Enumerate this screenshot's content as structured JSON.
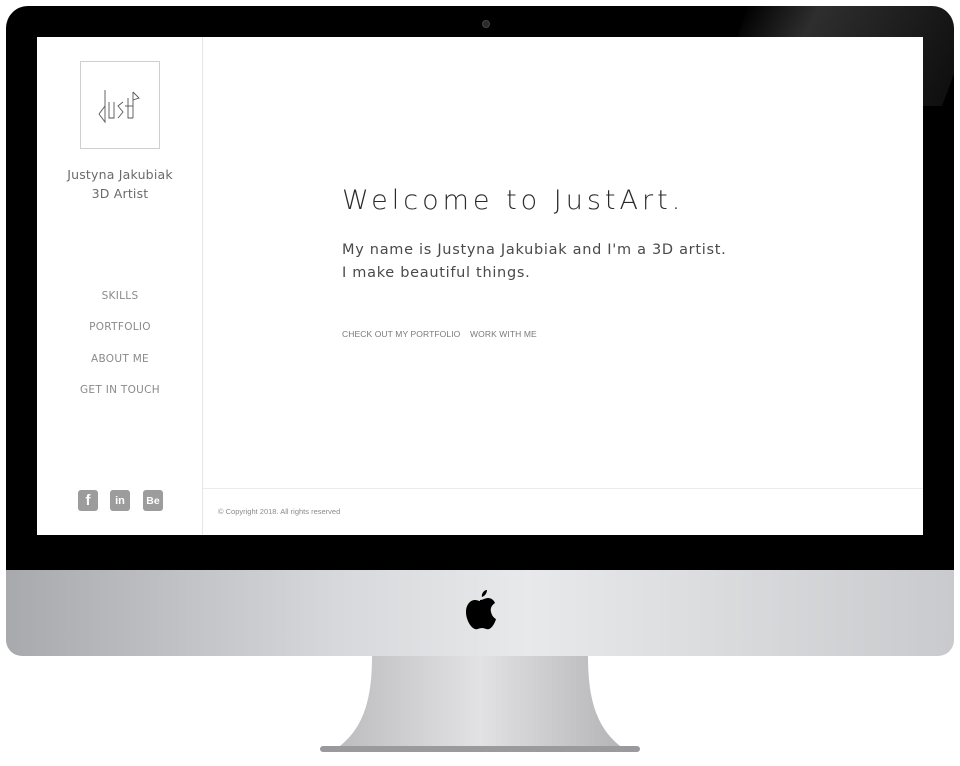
{
  "sidebar": {
    "logo_icon": "justart-logo-icon",
    "name": "Justyna Jakubiak",
    "title": "3D Artist",
    "nav": [
      {
        "label": "SKILLS"
      },
      {
        "label": "PORTFOLIO"
      },
      {
        "label": "ABOUT ME"
      },
      {
        "label": "GET IN TOUCH"
      }
    ],
    "social": [
      {
        "icon": "facebook-icon",
        "glyph": "f"
      },
      {
        "icon": "linkedin-icon",
        "glyph": "in"
      },
      {
        "icon": "behance-icon",
        "glyph": "Be"
      }
    ]
  },
  "main": {
    "heading": "Welcome to JustArt.",
    "intro_line1": "My name is Justyna Jakubiak and I'm a 3D artist.",
    "intro_line2": "I make beautiful things.",
    "cta_portfolio": "CHECK OUT MY PORTFOLIO",
    "cta_work": "WORK WITH ME"
  },
  "footer": {
    "copyright": "© Copyright 2018. All rights reserved"
  },
  "device": {
    "logo_icon": "apple-icon",
    "bezel_color": "#000000",
    "chin_color": "#d7d8db"
  }
}
